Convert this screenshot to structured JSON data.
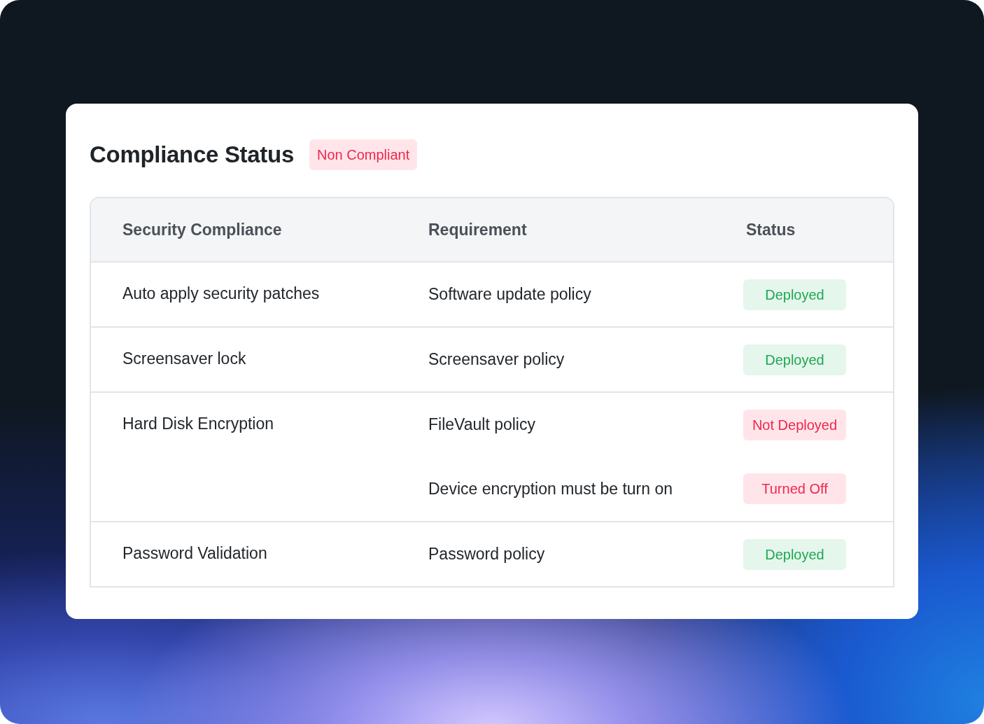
{
  "card": {
    "title": "Compliance Status",
    "badge": {
      "label": "Non Compliant",
      "kind": "danger"
    }
  },
  "table": {
    "columns": [
      "Security Compliance",
      "Requirement",
      "Status"
    ],
    "rows": [
      {
        "name": "Auto apply security patches",
        "requirements": [
          {
            "text": "Software update policy",
            "status": {
              "label": "Deployed",
              "kind": "success"
            }
          }
        ]
      },
      {
        "name": "Screensaver lock",
        "requirements": [
          {
            "text": "Screensaver policy",
            "status": {
              "label": "Deployed",
              "kind": "success"
            }
          }
        ]
      },
      {
        "name": "Hard Disk Encryption",
        "requirements": [
          {
            "text": "FileVault policy",
            "status": {
              "label": "Not Deployed",
              "kind": "danger"
            }
          },
          {
            "text": "Device encryption must be turn on",
            "status": {
              "label": "Turned Off",
              "kind": "danger"
            }
          }
        ]
      },
      {
        "name": "Password Validation",
        "requirements": [
          {
            "text": "Password policy",
            "status": {
              "label": "Deployed",
              "kind": "success"
            }
          }
        ]
      }
    ]
  }
}
